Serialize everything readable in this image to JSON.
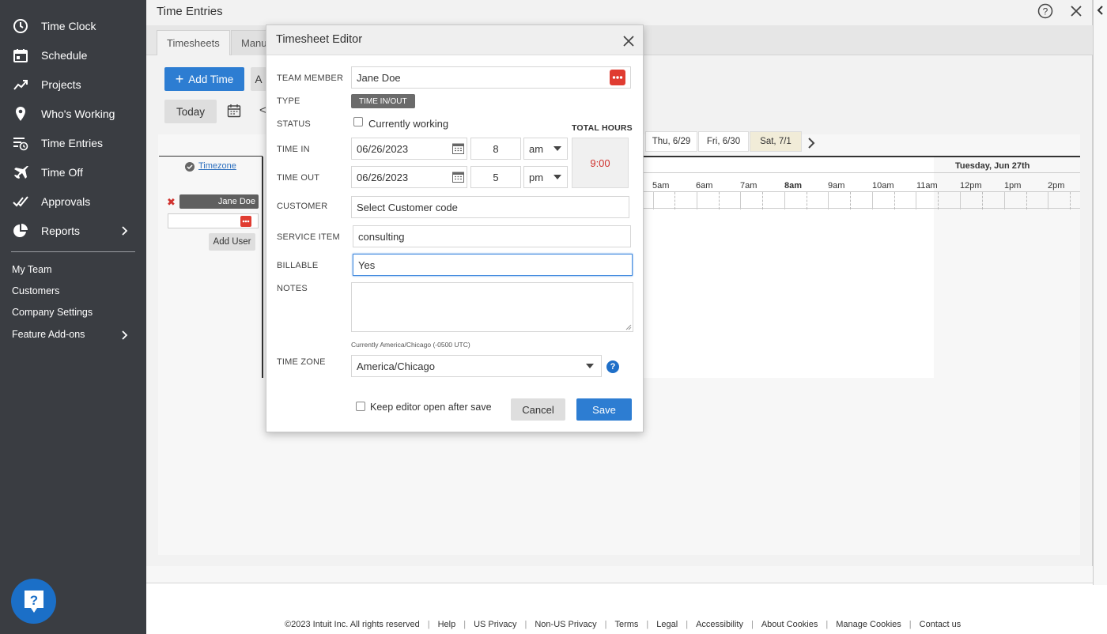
{
  "sidebar": {
    "items": [
      {
        "label": "Time Clock",
        "icon": "clock-icon"
      },
      {
        "label": "Schedule",
        "icon": "calendar-icon"
      },
      {
        "label": "Projects",
        "icon": "trend-icon"
      },
      {
        "label": "Who's Working",
        "icon": "location-pin-icon"
      },
      {
        "label": "Time Entries",
        "icon": "list-clock-icon"
      },
      {
        "label": "Time Off",
        "icon": "airplane-icon"
      },
      {
        "label": "Approvals",
        "icon": "double-check-icon"
      },
      {
        "label": "Reports",
        "icon": "pie-chart-icon"
      }
    ],
    "secondary": [
      {
        "label": "My Team"
      },
      {
        "label": "Customers"
      },
      {
        "label": "Company Settings"
      },
      {
        "label": "Feature Add-ons"
      }
    ]
  },
  "window": {
    "title": "Time Entries",
    "tabs": [
      "Timesheets",
      "Manu"
    ]
  },
  "toolbar": {
    "add_time": "Add Time",
    "add_time_sym": "+",
    "second_btn": "A",
    "today": "Today",
    "prev_sym": "<"
  },
  "list": {
    "timezone_link": "Timezone",
    "user_name": "Jane Doe",
    "remove_sym": "✖",
    "add_user": "Add User"
  },
  "week": {
    "days": [
      "Thu, 6/29",
      "Fri, 6/30",
      "Sat, 7/1"
    ],
    "selected_day": "Sat, 7/1",
    "date_header": "Tuesday, Jun 27th",
    "hours": [
      "5am",
      "6am",
      "7am",
      "8am",
      "9am",
      "10am",
      "11am",
      "12pm",
      "1pm",
      "2pm"
    ],
    "bold_hour": "8am"
  },
  "editor": {
    "title": "Timesheet Editor",
    "labels": {
      "team_member": "TEAM MEMBER",
      "type": "TYPE",
      "status": "STATUS",
      "time_in": "TIME IN",
      "time_out": "TIME OUT",
      "customer": "CUSTOMER",
      "service_item": "SERVICE ITEM",
      "billable": "BILLABLE",
      "notes": "NOTES",
      "time_zone": "TIME ZONE",
      "total_hours": "TOTAL HOURS"
    },
    "team_member": "Jane Doe",
    "type_badge": "TIME IN/OUT",
    "currently_working": "Currently working",
    "time_in": {
      "date": "06/26/2023",
      "hour": "8",
      "ampm": "am"
    },
    "time_out": {
      "date": "06/26/2023",
      "hour": "5",
      "ampm": "pm"
    },
    "total_hours": "9:00",
    "customer_placeholder": "Select Customer code",
    "service_item": "consulting",
    "billable": "Yes",
    "notes": "",
    "tz_note": "Currently America/Chicago (-0500 UTC)",
    "time_zone": "America/Chicago",
    "tz_help": "?",
    "keep_open": "Keep editor open after save",
    "cancel": "Cancel",
    "save": "Save"
  },
  "footer": {
    "items": [
      "©2023 Intuit Inc. All rights reserved",
      "Help",
      "US Privacy",
      "Non-US Privacy",
      "Terms",
      "Legal",
      "Accessibility",
      "About Cookies",
      "Manage Cookies",
      "Contact us"
    ],
    "separator": "|"
  },
  "colors": {
    "sidebar_bg": "#3a3d42",
    "accent": "#2d7dd2",
    "total_hours": "#d0312d",
    "picker_red": "#e03c31"
  }
}
